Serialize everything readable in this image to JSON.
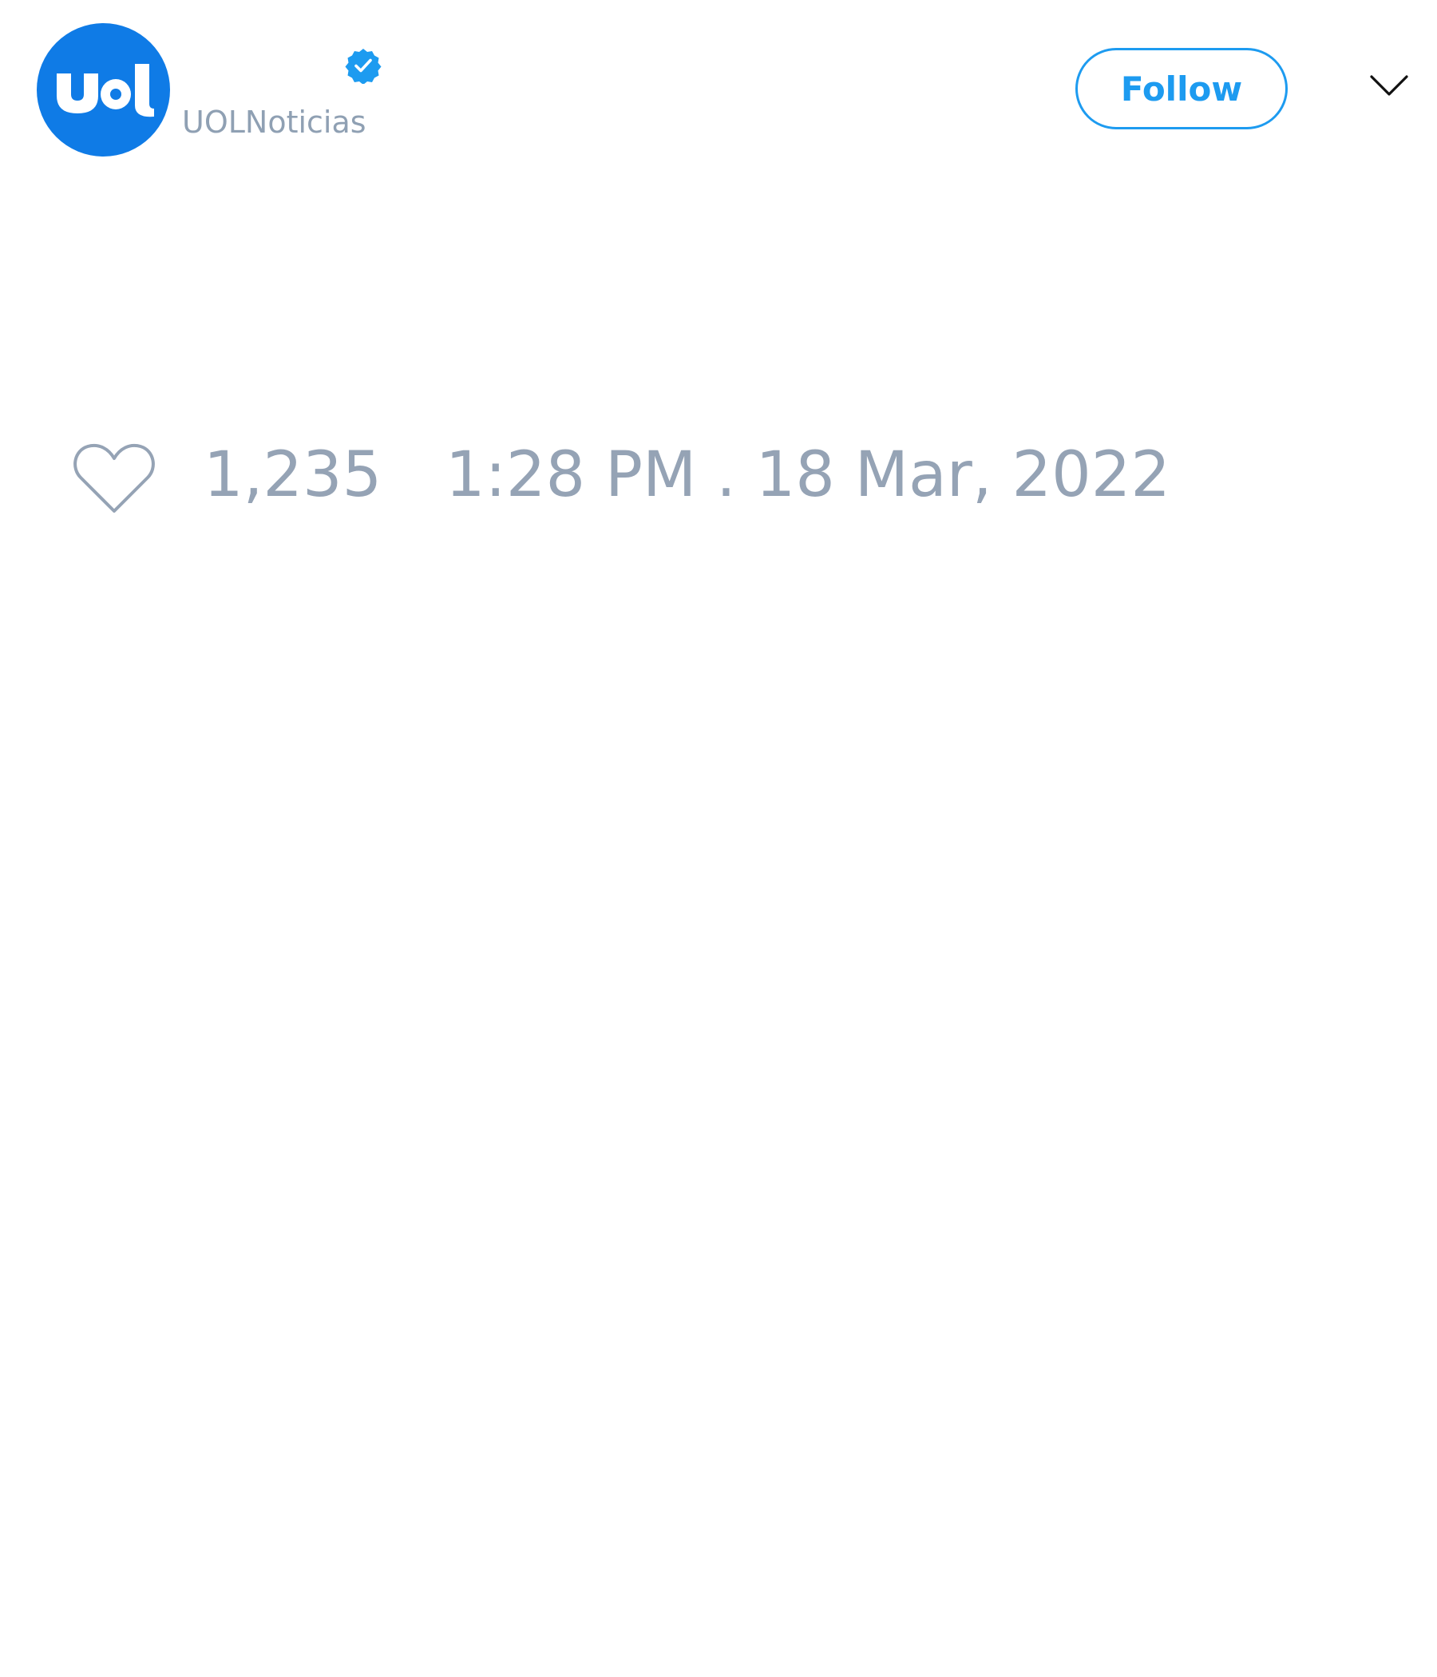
{
  "author": {
    "handle": "UOLNoticias",
    "verified": true,
    "avatar_logo_text": "uol",
    "avatar_color": "#0f7be6"
  },
  "actions": {
    "follow_label": "Follow",
    "menu_icon": "chevron-down-icon"
  },
  "stats": {
    "like_icon": "heart-outline-icon",
    "like_count": "1,235",
    "timestamp": "1:28 PM . 18 Mar, 2022"
  },
  "colors": {
    "accent": "#1d9bf0",
    "muted_text": "#95a3b5"
  }
}
